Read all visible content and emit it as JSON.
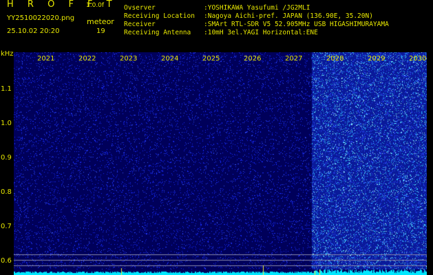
{
  "header": {
    "brand": "H R O F F T",
    "version": "1.0.0f",
    "filename": "YY2510022020.png",
    "datetime": "25.10.02 20:20",
    "event_type": "meteor",
    "event_count": "19"
  },
  "station": {
    "observer_label": "Ovserver",
    "observer_value": ":YOSHIKAWA Yasufumi /JG2MLI",
    "location_label": "Receiving Location",
    "location_value": ":Nagoya Aichi-pref. JAPAN (136.90E, 35.20N)",
    "receiver_label": "Receiver",
    "receiver_value": ":SMArt RTL-SDR V5 52.905MHz USB HIGASHIMURAYAMA",
    "antenna_label": "Receiving Antenna",
    "antenna_value": ":10mH 3el.YAGI Horizontal:ENE"
  },
  "axis": {
    "unit": "kHz",
    "y_ticks": [
      "1.1",
      "1.0",
      "0.9",
      "0.8",
      "0.7",
      "0.6"
    ],
    "x_ticks": [
      "2021",
      "2022",
      "2023",
      "2024",
      "2025",
      "2026",
      "2027",
      "2028",
      "2029",
      "2030"
    ]
  },
  "colors": {
    "label": "#e8e800",
    "background": "#00005a",
    "noise": "#1a2dff",
    "active_noise": "#30c8ff",
    "baseline": "#00e8ff"
  }
}
